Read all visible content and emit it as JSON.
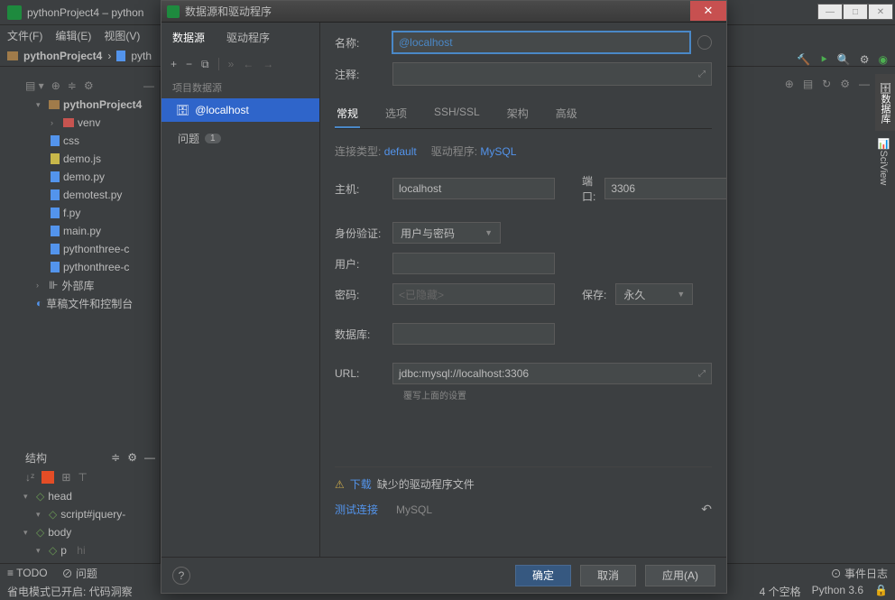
{
  "ide": {
    "title": "pythonProject4 – python",
    "menubar": [
      "文件(F)",
      "编辑(E)",
      "视图(V)"
    ],
    "breadcrumb": [
      "pythonProject4",
      "pyth"
    ],
    "project": {
      "root": "pythonProject4",
      "venv": "venv",
      "files": [
        "css",
        "demo.js",
        "demo.py",
        "demotest.py",
        "f.py",
        "main.py",
        "pythonthree-c",
        "pythonthree-c"
      ],
      "external": "外部库",
      "scratch": "草稿文件和控制台"
    },
    "structure": {
      "title": "结构",
      "items": [
        "head",
        "script#jquery-",
        "body",
        "p"
      ],
      "p_comment": "hi"
    },
    "right_tabs": [
      "数据库",
      "SciView"
    ],
    "status": {
      "todo": "TODO",
      "issues": "问题",
      "eventlog": "事件日志",
      "power": "省电模式已开启: 代码洞察",
      "spaces": "4 个空格",
      "python": "Python 3.6"
    }
  },
  "dialog": {
    "title": "数据源和驱动程序",
    "left_tabs": [
      "数据源",
      "驱动程序"
    ],
    "section": "项目数据源",
    "ds_name": "@localhost",
    "issues_label": "问题",
    "issues_count": "1",
    "right": {
      "name_label": "名称:",
      "name_value": "@localhost",
      "desc_label": "注释:",
      "tabs": [
        "常规",
        "选项",
        "SSH/SSL",
        "架构",
        "高级"
      ],
      "meta_conn_label": "连接类型:",
      "meta_conn_value": "default",
      "meta_driver_label": "驱动程序:",
      "meta_driver_value": "MySQL",
      "host_label": "主机:",
      "host_value": "localhost",
      "port_label": "端口:",
      "port_value": "3306",
      "auth_label": "身份验证:",
      "auth_value": "用户与密码",
      "user_label": "用户:",
      "pass_label": "密码:",
      "pass_placeholder": "<已隐藏>",
      "save_label": "保存:",
      "save_value": "永久",
      "db_label": "数据库:",
      "url_label": "URL:",
      "url_value": "jdbc:mysql://localhost:3306",
      "reset_hint": "覆写上面的设置",
      "warn_download": "下载",
      "warn_text": "缺少的驱动程序文件",
      "test_link": "测试连接",
      "mysql_label": "MySQL",
      "btn_ok": "确定",
      "btn_cancel": "取消",
      "btn_apply": "应用(A)"
    }
  }
}
